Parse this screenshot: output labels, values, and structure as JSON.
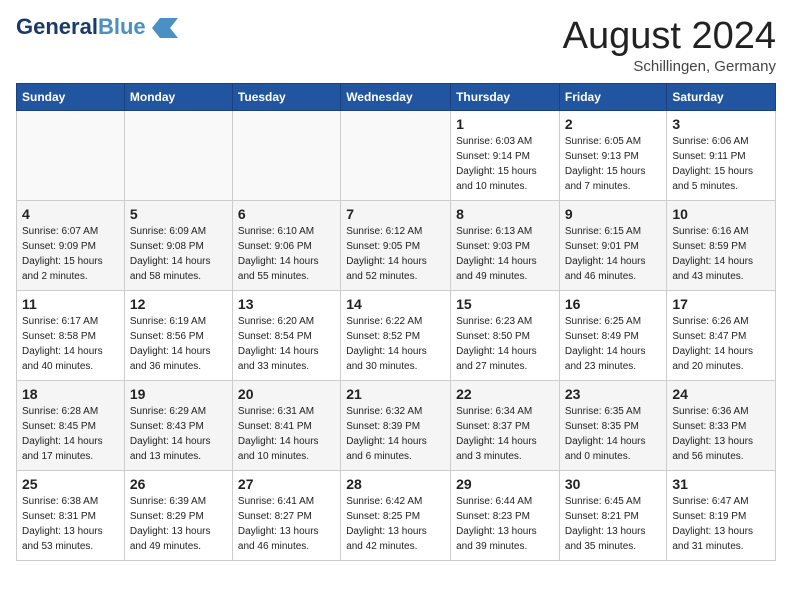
{
  "header": {
    "logo_general": "General",
    "logo_blue": "Blue",
    "month_year": "August 2024",
    "location": "Schillingen, Germany"
  },
  "days_of_week": [
    "Sunday",
    "Monday",
    "Tuesday",
    "Wednesday",
    "Thursday",
    "Friday",
    "Saturday"
  ],
  "weeks": [
    [
      {
        "day": "",
        "sunrise": "",
        "sunset": "",
        "daylight": ""
      },
      {
        "day": "",
        "sunrise": "",
        "sunset": "",
        "daylight": ""
      },
      {
        "day": "",
        "sunrise": "",
        "sunset": "",
        "daylight": ""
      },
      {
        "day": "",
        "sunrise": "",
        "sunset": "",
        "daylight": ""
      },
      {
        "day": "1",
        "sunrise": "Sunrise: 6:03 AM",
        "sunset": "Sunset: 9:14 PM",
        "daylight": "Daylight: 15 hours and 10 minutes."
      },
      {
        "day": "2",
        "sunrise": "Sunrise: 6:05 AM",
        "sunset": "Sunset: 9:13 PM",
        "daylight": "Daylight: 15 hours and 7 minutes."
      },
      {
        "day": "3",
        "sunrise": "Sunrise: 6:06 AM",
        "sunset": "Sunset: 9:11 PM",
        "daylight": "Daylight: 15 hours and 5 minutes."
      }
    ],
    [
      {
        "day": "4",
        "sunrise": "Sunrise: 6:07 AM",
        "sunset": "Sunset: 9:09 PM",
        "daylight": "Daylight: 15 hours and 2 minutes."
      },
      {
        "day": "5",
        "sunrise": "Sunrise: 6:09 AM",
        "sunset": "Sunset: 9:08 PM",
        "daylight": "Daylight: 14 hours and 58 minutes."
      },
      {
        "day": "6",
        "sunrise": "Sunrise: 6:10 AM",
        "sunset": "Sunset: 9:06 PM",
        "daylight": "Daylight: 14 hours and 55 minutes."
      },
      {
        "day": "7",
        "sunrise": "Sunrise: 6:12 AM",
        "sunset": "Sunset: 9:05 PM",
        "daylight": "Daylight: 14 hours and 52 minutes."
      },
      {
        "day": "8",
        "sunrise": "Sunrise: 6:13 AM",
        "sunset": "Sunset: 9:03 PM",
        "daylight": "Daylight: 14 hours and 49 minutes."
      },
      {
        "day": "9",
        "sunrise": "Sunrise: 6:15 AM",
        "sunset": "Sunset: 9:01 PM",
        "daylight": "Daylight: 14 hours and 46 minutes."
      },
      {
        "day": "10",
        "sunrise": "Sunrise: 6:16 AM",
        "sunset": "Sunset: 8:59 PM",
        "daylight": "Daylight: 14 hours and 43 minutes."
      }
    ],
    [
      {
        "day": "11",
        "sunrise": "Sunrise: 6:17 AM",
        "sunset": "Sunset: 8:58 PM",
        "daylight": "Daylight: 14 hours and 40 minutes."
      },
      {
        "day": "12",
        "sunrise": "Sunrise: 6:19 AM",
        "sunset": "Sunset: 8:56 PM",
        "daylight": "Daylight: 14 hours and 36 minutes."
      },
      {
        "day": "13",
        "sunrise": "Sunrise: 6:20 AM",
        "sunset": "Sunset: 8:54 PM",
        "daylight": "Daylight: 14 hours and 33 minutes."
      },
      {
        "day": "14",
        "sunrise": "Sunrise: 6:22 AM",
        "sunset": "Sunset: 8:52 PM",
        "daylight": "Daylight: 14 hours and 30 minutes."
      },
      {
        "day": "15",
        "sunrise": "Sunrise: 6:23 AM",
        "sunset": "Sunset: 8:50 PM",
        "daylight": "Daylight: 14 hours and 27 minutes."
      },
      {
        "day": "16",
        "sunrise": "Sunrise: 6:25 AM",
        "sunset": "Sunset: 8:49 PM",
        "daylight": "Daylight: 14 hours and 23 minutes."
      },
      {
        "day": "17",
        "sunrise": "Sunrise: 6:26 AM",
        "sunset": "Sunset: 8:47 PM",
        "daylight": "Daylight: 14 hours and 20 minutes."
      }
    ],
    [
      {
        "day": "18",
        "sunrise": "Sunrise: 6:28 AM",
        "sunset": "Sunset: 8:45 PM",
        "daylight": "Daylight: 14 hours and 17 minutes."
      },
      {
        "day": "19",
        "sunrise": "Sunrise: 6:29 AM",
        "sunset": "Sunset: 8:43 PM",
        "daylight": "Daylight: 14 hours and 13 minutes."
      },
      {
        "day": "20",
        "sunrise": "Sunrise: 6:31 AM",
        "sunset": "Sunset: 8:41 PM",
        "daylight": "Daylight: 14 hours and 10 minutes."
      },
      {
        "day": "21",
        "sunrise": "Sunrise: 6:32 AM",
        "sunset": "Sunset: 8:39 PM",
        "daylight": "Daylight: 14 hours and 6 minutes."
      },
      {
        "day": "22",
        "sunrise": "Sunrise: 6:34 AM",
        "sunset": "Sunset: 8:37 PM",
        "daylight": "Daylight: 14 hours and 3 minutes."
      },
      {
        "day": "23",
        "sunrise": "Sunrise: 6:35 AM",
        "sunset": "Sunset: 8:35 PM",
        "daylight": "Daylight: 14 hours and 0 minutes."
      },
      {
        "day": "24",
        "sunrise": "Sunrise: 6:36 AM",
        "sunset": "Sunset: 8:33 PM",
        "daylight": "Daylight: 13 hours and 56 minutes."
      }
    ],
    [
      {
        "day": "25",
        "sunrise": "Sunrise: 6:38 AM",
        "sunset": "Sunset: 8:31 PM",
        "daylight": "Daylight: 13 hours and 53 minutes."
      },
      {
        "day": "26",
        "sunrise": "Sunrise: 6:39 AM",
        "sunset": "Sunset: 8:29 PM",
        "daylight": "Daylight: 13 hours and 49 minutes."
      },
      {
        "day": "27",
        "sunrise": "Sunrise: 6:41 AM",
        "sunset": "Sunset: 8:27 PM",
        "daylight": "Daylight: 13 hours and 46 minutes."
      },
      {
        "day": "28",
        "sunrise": "Sunrise: 6:42 AM",
        "sunset": "Sunset: 8:25 PM",
        "daylight": "Daylight: 13 hours and 42 minutes."
      },
      {
        "day": "29",
        "sunrise": "Sunrise: 6:44 AM",
        "sunset": "Sunset: 8:23 PM",
        "daylight": "Daylight: 13 hours and 39 minutes."
      },
      {
        "day": "30",
        "sunrise": "Sunrise: 6:45 AM",
        "sunset": "Sunset: 8:21 PM",
        "daylight": "Daylight: 13 hours and 35 minutes."
      },
      {
        "day": "31",
        "sunrise": "Sunrise: 6:47 AM",
        "sunset": "Sunset: 8:19 PM",
        "daylight": "Daylight: 13 hours and 31 minutes."
      }
    ]
  ]
}
